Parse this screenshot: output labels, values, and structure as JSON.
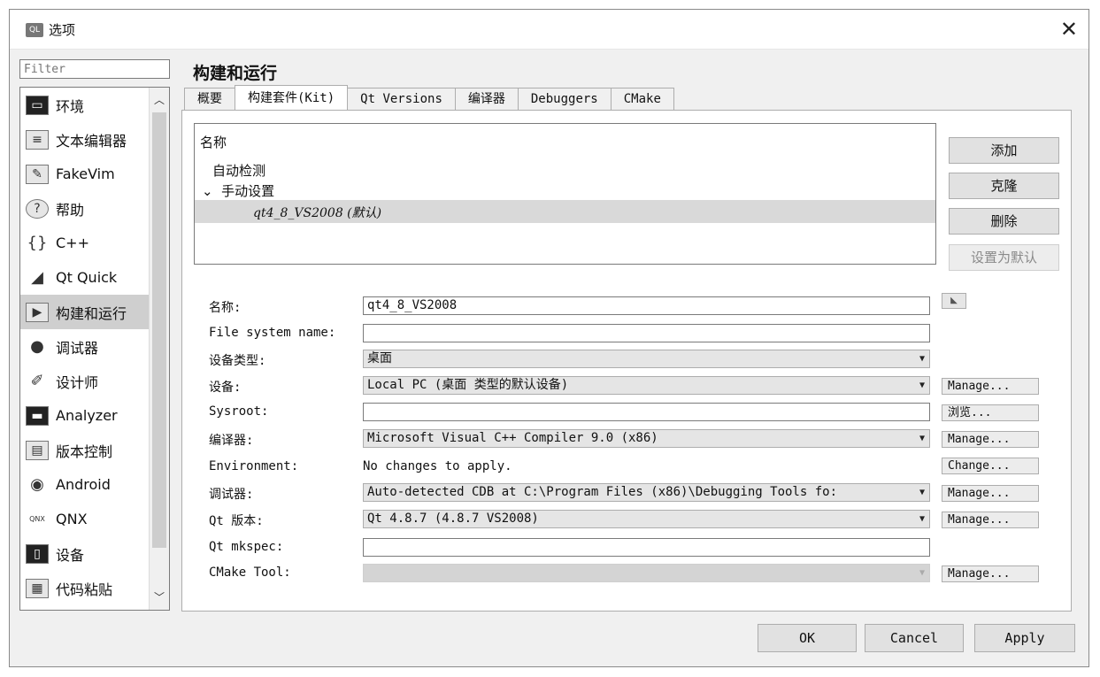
{
  "window": {
    "title": "选项",
    "app_icon": "QL"
  },
  "filter": {
    "placeholder": "Filter"
  },
  "nav": {
    "items": [
      {
        "label": "环境",
        "icon": "monitor-icon"
      },
      {
        "label": "文本编辑器",
        "icon": "text-editor-icon"
      },
      {
        "label": "FakeVim",
        "icon": "fakevim-icon"
      },
      {
        "label": "帮助",
        "icon": "help-icon"
      },
      {
        "label": "C++",
        "icon": "braces-icon"
      },
      {
        "label": "Qt Quick",
        "icon": "paper-plane-icon"
      },
      {
        "label": "构建和运行",
        "icon": "build-run-icon"
      },
      {
        "label": "调试器",
        "icon": "debugger-icon"
      },
      {
        "label": "设计师",
        "icon": "designer-icon"
      },
      {
        "label": "Analyzer",
        "icon": "analyzer-icon"
      },
      {
        "label": "版本控制",
        "icon": "version-control-icon"
      },
      {
        "label": "Android",
        "icon": "android-icon"
      },
      {
        "label": "QNX",
        "icon": "qnx-icon"
      },
      {
        "label": "设备",
        "icon": "device-icon"
      },
      {
        "label": "代码粘贴",
        "icon": "code-paste-icon"
      }
    ],
    "selected_index": 6
  },
  "section": {
    "title": "构建和运行"
  },
  "tabs": [
    {
      "label": "概要",
      "active": false
    },
    {
      "label": "构建套件(Kit)",
      "active": true
    },
    {
      "label": "Qt Versions",
      "active": false
    },
    {
      "label": "编译器",
      "active": false
    },
    {
      "label": "Debuggers",
      "active": false
    },
    {
      "label": "CMake",
      "active": false
    }
  ],
  "kits": {
    "header": "名称",
    "auto_group": "自动检测",
    "manual_group": "手动设置",
    "manual_expanded_marker": "⌄",
    "selected_kit": "qt4_8_VS2008 (默认)"
  },
  "side_buttons": {
    "add": "添加",
    "clone": "克隆",
    "remove": "删除",
    "make_default": "设置为默认"
  },
  "form": {
    "name_label": "名称:",
    "name_value": "qt4_8_VS2008",
    "fs_name_label": "File system name:",
    "fs_name_value": "",
    "device_type_label": "设备类型:",
    "device_type_value": "桌面",
    "device_label": "设备:",
    "device_value": "Local PC (桌面 类型的默认设备)",
    "device_button": "Manage...",
    "sysroot_label": "Sysroot:",
    "sysroot_value": "",
    "sysroot_button": "浏览...",
    "compiler_label": "编译器:",
    "compiler_value": "Microsoft Visual C++ Compiler 9.0 (x86)",
    "compiler_button": "Manage...",
    "environment_label": "Environment:",
    "environment_value": "No changes to apply.",
    "environment_button": "Change...",
    "debugger_label": "调试器:",
    "debugger_value": "Auto-detected CDB at C:\\Program Files (x86)\\Debugging Tools fo:",
    "debugger_button": "Manage...",
    "qt_version_label": "Qt 版本:",
    "qt_version_value": "Qt 4.8.7 (4.8.7 VS2008)",
    "qt_version_button": "Manage...",
    "mkspec_label": "Qt mkspec:",
    "mkspec_value": "",
    "cmake_label": "CMake Tool:",
    "cmake_value": "",
    "cmake_button": "Manage..."
  },
  "dialog_buttons": {
    "ok": "OK",
    "cancel": "Cancel",
    "apply": "Apply"
  }
}
